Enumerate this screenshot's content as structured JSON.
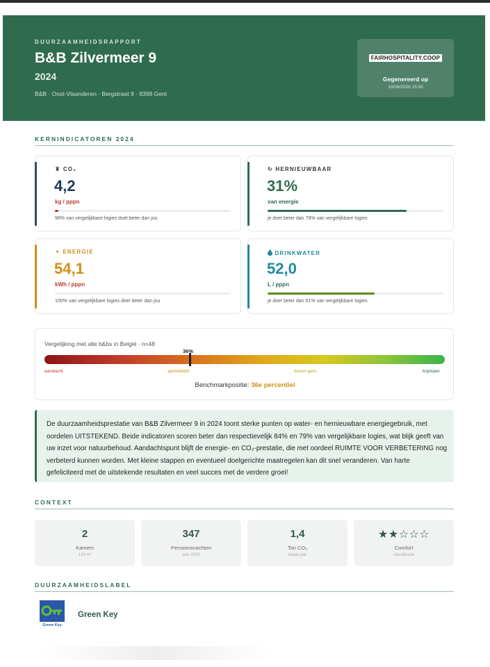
{
  "header": {
    "kicker": "DUURZAAMHEIDSRAPPORT",
    "title": "B&B Zilvermeer 9",
    "year": "2024",
    "address": "B&B · Oost-Vlaanderen · Bergstraat 9 · 9398 Gent",
    "logo_text": "FAIRHOSPITALITY.COOP",
    "generated_label": "Gegenereerd op",
    "generated_date": "10/08/2026 15:00",
    "background_color": "#2f6b4f"
  },
  "kpi_section": {
    "title": "KERNINDICATOREN 2024",
    "cards": [
      {
        "label": "CO₂",
        "icon": "factory-icon",
        "icon_glyph": "♜",
        "value": "4,2",
        "unit": "kg / pppn",
        "note": "98% van vergelijkbare logies doet beter dan jou",
        "progress": 0.02,
        "accent": "#2f4a6b",
        "label_color": "#333333",
        "value_color": "#223a5e",
        "unit_color": "#c0392b",
        "fill_color": "#c0392b"
      },
      {
        "label": "HERNIEUWBAAR",
        "icon": "refresh-icon",
        "icon_glyph": "↻",
        "value": "31%",
        "unit": "van energie",
        "note": "je doet beter dan 79% van vergelijkbare logies",
        "progress": 0.79,
        "accent": "#2f6b4f",
        "label_color": "#333333",
        "value_color": "#2f6b4f",
        "unit_color": "#2f6b4f",
        "fill_color": "#2f6b4f"
      },
      {
        "label": "ENERGIE",
        "icon": "lightning-icon",
        "icon_glyph": "✦",
        "value": "54,1",
        "unit": "kWh / pppn",
        "note": "100% van vergelijkbare logies doet beter dan jou",
        "progress": 0.0,
        "accent": "#d38f14",
        "label_color": "#d38f14",
        "value_color": "#d38f14",
        "unit_color": "#c0392b",
        "fill_color": "#c0392b"
      },
      {
        "label": "DRINKWATER",
        "icon": "water-drop-icon",
        "icon_glyph": "💧",
        "value": "52,0",
        "unit": "L / pppn",
        "note": "je doet beter dan 61% van vergelijkbare logies",
        "progress": 0.61,
        "accent": "#1f8a9e",
        "label_color": "#1f8a9e",
        "value_color": "#1f8a9e",
        "unit_color": "#2f6b4f",
        "fill_color": "#5e8a1f"
      }
    ]
  },
  "benchmark": {
    "title": "Vergelijking met alle b&bs in België · n=48",
    "marker_label": "36%",
    "percentile": 0.36,
    "ticks": [
      {
        "label": "aandacht",
        "color": "#c0392b"
      },
      {
        "label": "gemiddeld",
        "color": "#d38f14"
      },
      {
        "label": "boven gem.",
        "color": "#b8a21f"
      },
      {
        "label": "koploper",
        "color": "#2f6b4f"
      }
    ],
    "position_label": "Benchmarkpositie:",
    "position_value": "36e percentiel"
  },
  "summary": {
    "text": "De duurzaamheidsprestatie van B&B Zilvermeer 9 in 2024 toont sterke punten op water- en hernieuwbare energiegebruik, met oordelen UITSTEKEND. Beide indicatoren scoren beter dan respectievelijk 84% en 79% van vergelijkbare logies, wat blijk geeft van uw inzet voor natuurbehoud. Aandachtspunt blijft de energie- en CO₂-prestatie, die met oordeel RUIMTE VOOR VERBETERING nog verbeterd kunnen worden. Met kleine stappen en eventueel doelgerichte maatregelen kan dit snel veranderen. Van harte gefeliciteerd met de uitstekende resultaten en veel succes met de verdere groei!"
  },
  "context": {
    "title": "CONTEXT",
    "items": [
      {
        "value": "2",
        "label": "Kamers",
        "sub": "124 m²"
      },
      {
        "value": "347",
        "label": "Persoonsnachten",
        "sub": "jaar 2024"
      },
      {
        "value": "1,4",
        "label": "Ton CO₂",
        "sub": "totaal jaar"
      },
      {
        "value": "★★☆☆☆",
        "label": "Comfort",
        "sub": "classificatie",
        "stars": 2
      }
    ]
  },
  "label_section": {
    "title": "DUURZAAMHEIDSLABEL",
    "label_name": "Green Key",
    "logo_caption": "Green Key",
    "logo_icon": "key-icon"
  }
}
